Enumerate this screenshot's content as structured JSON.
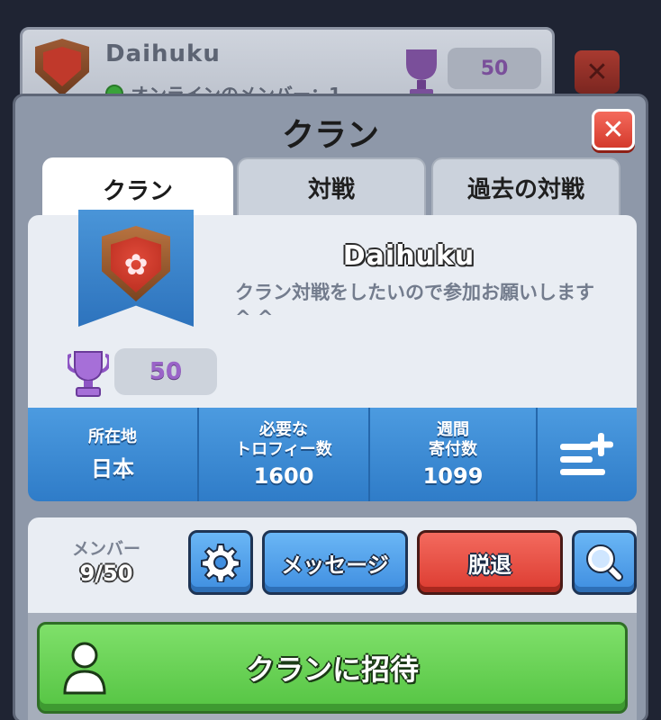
{
  "background_card": {
    "clan_name": "Daihuku",
    "online_text": "オンラインのメンバー：1",
    "trophies": "50"
  },
  "modal": {
    "title": "クラン",
    "tabs": [
      {
        "label": "クラン",
        "active": true
      },
      {
        "label": "対戦",
        "active": false
      },
      {
        "label": "過去の対戦",
        "active": false
      }
    ]
  },
  "clan": {
    "name": "Daihuku",
    "description": "クラン対戦をしたいので参加お願いします^ ^",
    "trophies": "50"
  },
  "stats": {
    "location_label": "所在地",
    "location_value": "日本",
    "required_label_1": "必要な",
    "required_label_2": "トロフィー数",
    "required_value": "1600",
    "weekly_label_1": "週間",
    "weekly_label_2": "寄付数",
    "weekly_value": "1099"
  },
  "members": {
    "label": "メンバー",
    "count": "9/50"
  },
  "buttons": {
    "message": "メッセージ",
    "leave": "脱退",
    "invite": "クランに招待"
  },
  "colors": {
    "accent_blue": "#3f8ee0",
    "leave_red": "#dc3b30",
    "invite_green": "#55c443",
    "trophy_purple": "#9a64c8"
  }
}
